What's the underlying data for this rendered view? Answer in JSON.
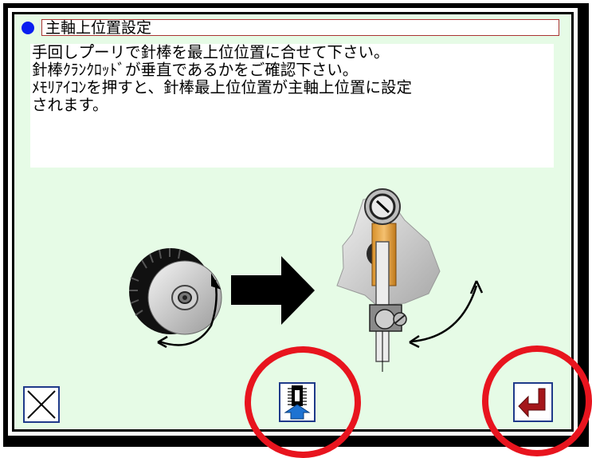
{
  "window": {
    "title": "主軸上位置設定"
  },
  "message": {
    "lines": [
      "手回しプ゚ーリで針棒を最上位位置に合せて下さい。",
      "針棒ｸﾗﾝｸﾛｯﾄﾞが垂直であるかをご確認下さい。",
      "ﾒﾓﾘｱｲｺﾝを押すと、針棒最上位位置が主軸上位置に設定",
      "されます。"
    ]
  },
  "illustration": {
    "pulley_icon": "handwheel-pulley-icon",
    "arrow_icon": "right-arrow-icon",
    "needle_bar_icon": "needle-bar-crank-icon"
  },
  "buttons": {
    "close_icon": "close-x-icon",
    "memory_icon": "memory-upload-icon",
    "enter_icon": "enter-return-icon"
  },
  "colors": {
    "screen_bg": "#e6fbe6",
    "title_dot": "#0a1ef0",
    "highlight_ring": "#e8141e",
    "enter_arrow": "#a4161a",
    "memory_arrow": "#1e73d2"
  }
}
